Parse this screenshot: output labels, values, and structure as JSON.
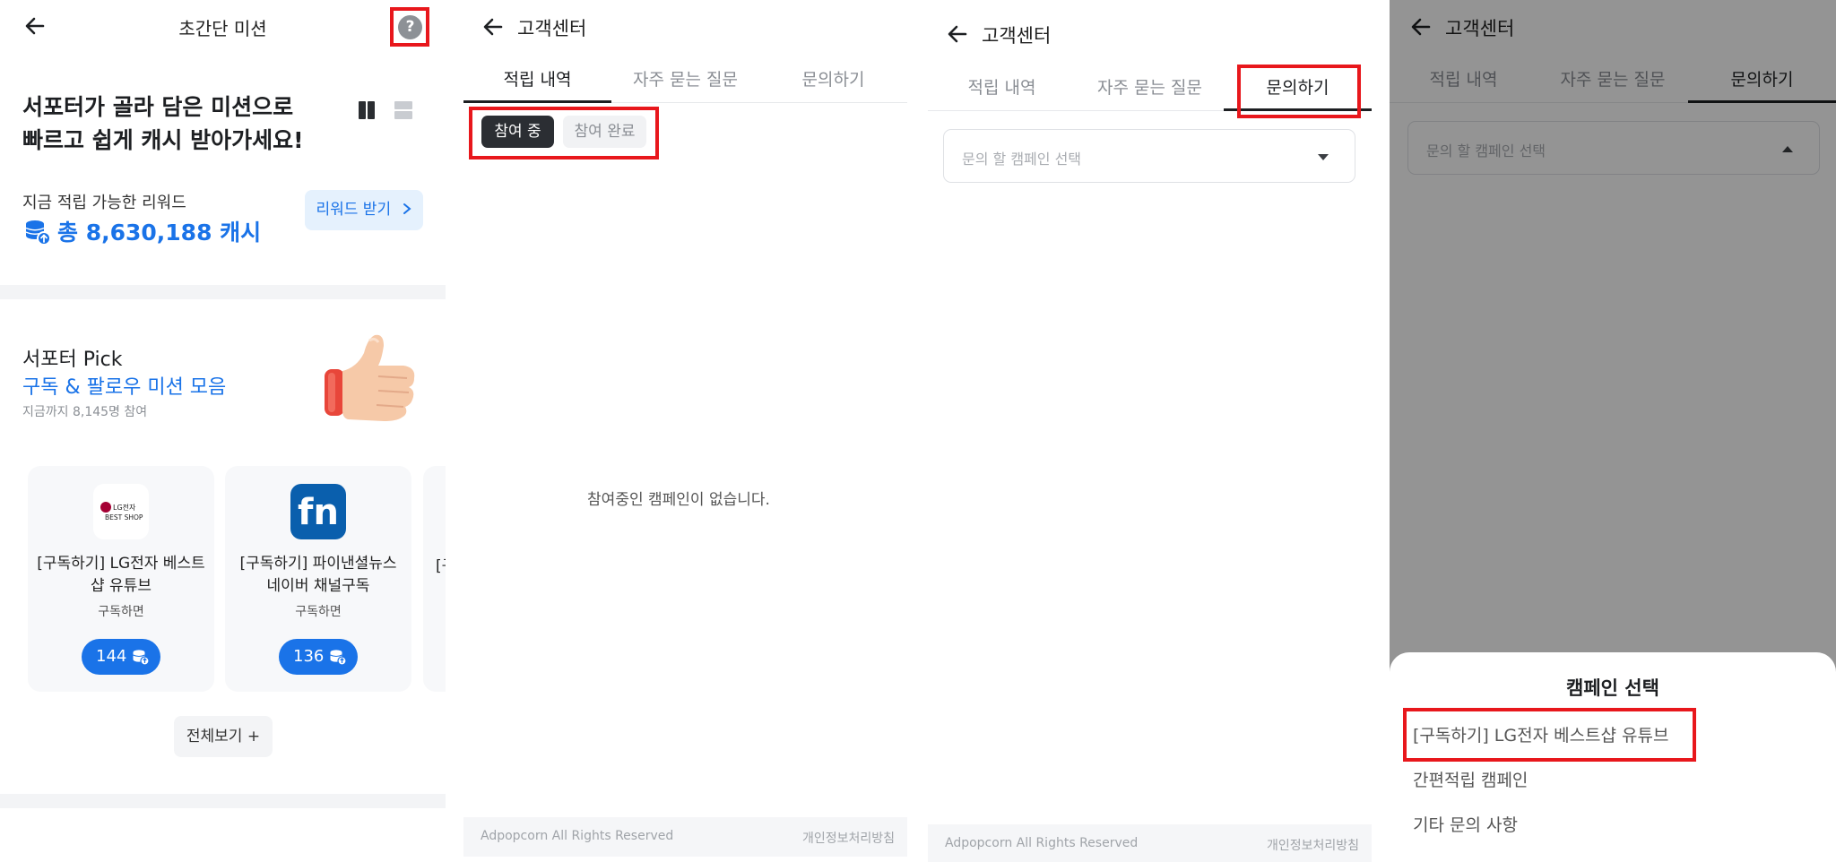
{
  "panel1": {
    "title": "초간단 미션",
    "help_icon": "?",
    "headline_line1": "서포터가 골라 담은 미션으로",
    "headline_line2": "빠르고 쉽게 캐시 받아가세요!",
    "reward_caption": "지금 적립 가능한 리워드",
    "reward_total": "총 8,630,188 캐시",
    "reward_button": "리워드 받기",
    "pick_title": "서포터 Pick",
    "pick_subtitle": "구독 & 팔로우 미션 모음",
    "pick_count": "지금까지 8,145명 참여",
    "cards": [
      {
        "logo_line1": "LG전자",
        "logo_line2": "BEST SHOP",
        "name": "[구독하기] LG전자 베스트샵 유튜브",
        "condition": "구독하면",
        "reward": "144"
      },
      {
        "logo_text": "fn",
        "name": "[구독하기] 파이낸셜뉴스 네이버 채널구독",
        "condition": "구독하면",
        "reward": "136"
      }
    ],
    "card_partial_text": "[구",
    "view_all": "전체보기 +"
  },
  "panel2": {
    "title": "고객센터",
    "tabs": [
      "적립 내역",
      "자주 묻는 질문",
      "문의하기"
    ],
    "active_tab": "적립 내역",
    "chips": [
      "참여 중",
      "참여 완료"
    ],
    "empty_message": "참여중인 캠페인이 없습니다.",
    "footer_left": "Adpopcorn All Rights Reserved",
    "footer_right": "개인정보처리방침"
  },
  "panel3": {
    "title": "고객센터",
    "tabs": [
      "적립 내역",
      "자주 묻는 질문",
      "문의하기"
    ],
    "active_tab": "문의하기",
    "select_placeholder": "문의 할 캠페인 선택",
    "footer_left": "Adpopcorn All Rights Reserved",
    "footer_right": "개인정보처리방침"
  },
  "panel4": {
    "title": "고객센터",
    "tabs": [
      "적립 내역",
      "자주 묻는 질문",
      "문의하기"
    ],
    "active_tab": "문의하기",
    "select_placeholder": "문의 할 캠페인 선택",
    "sheet_title": "캠페인 선택",
    "options": [
      "[구독하기] LG전자 베스트샵 유튜브",
      "간편적립 캠페인",
      "기타 문의 사항"
    ]
  },
  "colors": {
    "accent": "#1a73e8",
    "accent_light": "#e5f1fd",
    "highlight_box": "#e8171c",
    "text_dark": "#1d1f22",
    "muted": "#8a8e94",
    "surface": "#f7f8fa"
  },
  "icons": [
    "back-arrow-icon",
    "help-icon",
    "grid-view-icon",
    "list-view-icon",
    "coin-stack-icon",
    "chevron-right-icon",
    "thumbs-up-icon",
    "dropdown-caret-icon"
  ]
}
